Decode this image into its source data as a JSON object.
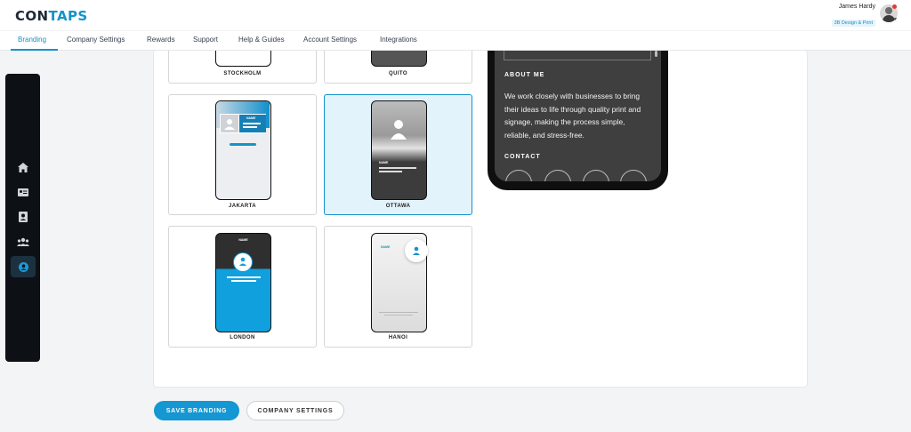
{
  "header": {
    "logo_part1": "CON",
    "logo_part2": "TAPS",
    "user_name": "James Hardy",
    "user_company": "3B Design & Print"
  },
  "tabs": [
    {
      "label": "Branding",
      "active": true
    },
    {
      "label": "Company Settings"
    },
    {
      "label": "Rewards"
    },
    {
      "label": "Support"
    },
    {
      "label": "Help & Guides"
    },
    {
      "label": "Account Settings"
    },
    {
      "label": "Integrations"
    }
  ],
  "sidenav": {
    "icons": [
      "home-icon",
      "id-card-icon",
      "contact-book-icon",
      "team-icon",
      "user-profile-icon"
    ],
    "active_index": 4
  },
  "templates": {
    "stockholm": {
      "label": "STOCKHOLM"
    },
    "quito": {
      "label": "QUITO"
    },
    "jakarta": {
      "label": "JAKARTA",
      "mini_name": "NAME"
    },
    "ottawa": {
      "label": "OTTAWA",
      "mini_name": "NAME",
      "selected": true
    },
    "london": {
      "label": "LONDON",
      "mini_name": "NAME"
    },
    "hanoi": {
      "label": "HANOI",
      "mini_name": "NAME"
    }
  },
  "preview": {
    "about_heading": "ABOUT ME",
    "about_text": "We work closely with businesses to bring their ideas to life through quality print and signage, making the process simple, reliable, and stress-free.",
    "contact_heading": "CONTACT",
    "contact_icons": [
      "email-icon",
      "phone-icon",
      "mobile-icon",
      "website-icon"
    ]
  },
  "actions": {
    "save_label": "SAVE BRANDING",
    "company_settings_label": "COMPANY SETTINGS"
  },
  "colors": {
    "accent": "#1493c8",
    "nav_bg": "#0d1116",
    "selected_bg": "#e2f3fb"
  }
}
